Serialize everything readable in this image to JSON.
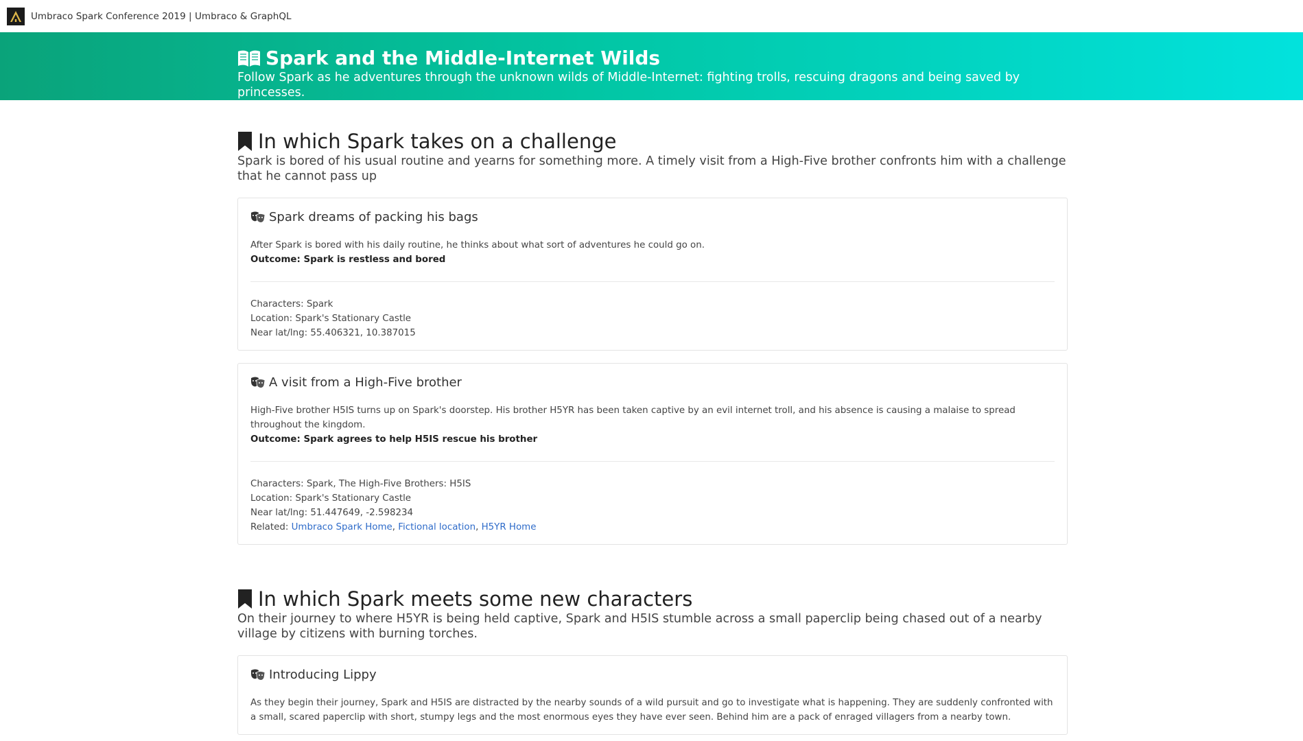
{
  "site": {
    "title": "Umbraco Spark Conference 2019 | Umbraco & GraphQL"
  },
  "hero": {
    "title": "Spark and the Middle-Internet Wilds",
    "subtitle": "Follow Spark as he adventures through the unknown wilds of Middle-Internet: fighting trolls, rescuing dragons and being saved by princesses."
  },
  "chapters": [
    {
      "title": "In which Spark takes on a challenge",
      "description": "Spark is bored of his usual routine and yearns for something more. A timely visit from a High-Five brother confronts him with a challenge that he cannot pass up",
      "scenes": [
        {
          "title": "Spark dreams of packing his bags",
          "body": "After Spark is bored with his daily routine, he thinks about what sort of adventures he could go on.",
          "outcome": "Outcome: Spark is restless and bored",
          "characters": "Characters: Spark",
          "location": "Location: Spark's Stationary Castle",
          "latlng": "Near lat/lng: 55.406321, 10.387015"
        },
        {
          "title": "A visit from a High-Five brother",
          "body": "High-Five brother H5IS turns up on Spark's doorstep. His brother H5YR has been taken captive by an evil internet troll, and his absence is causing a malaise to spread throughout the kingdom.",
          "outcome": "Outcome: Spark agrees to help H5IS rescue his brother",
          "characters": "Characters: Spark, The High-Five Brothers: H5IS",
          "location": "Location: Spark's Stationary Castle",
          "latlng": "Near lat/lng: 51.447649, -2.598234",
          "related_label": "Related: ",
          "related_links": [
            "Umbraco Spark Home",
            "Fictional location",
            "H5YR Home"
          ],
          "related_sep": ", "
        }
      ]
    },
    {
      "title": "In which Spark meets some new characters",
      "description": "On their journey to where H5YR is being held captive, Spark and H5IS stumble across a small paperclip being chased out of a nearby village by citizens with burning torches.",
      "scenes": [
        {
          "title": "Introducing Lippy",
          "body": "As they begin their journey, Spark and H5IS are distracted by the nearby sounds of a wild pursuit and go to investigate what is happening. They are suddenly confronted with a small, scared paperclip with short, stumpy legs and the most enormous eyes they have ever seen. Behind him are a pack of enraged villagers from a nearby town."
        }
      ]
    }
  ],
  "icons": {
    "logo": "umbraco-spark-logo",
    "hero": "open-book-icon",
    "chapter": "bookmark-icon",
    "scene": "theater-masks-icon"
  },
  "colors": {
    "hero_gradient_start": "#0aa37a",
    "hero_gradient_end": "#02e2dd",
    "link": "#2e6bc9"
  }
}
